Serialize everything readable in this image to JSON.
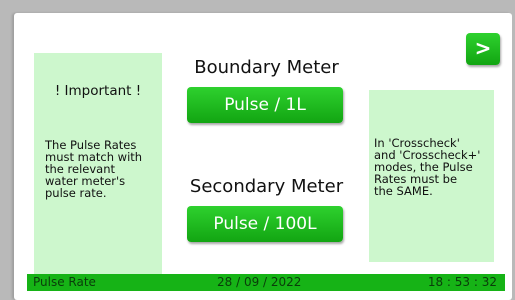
{
  "left_note": {
    "title": "! Important !",
    "body": "The Pulse Rates\nmust match with\nthe relevant\nwater meter's\npulse rate."
  },
  "right_note": {
    "body": "In 'Crosscheck'\nand 'Crosscheck+'\nmodes, the Pulse\nRates must be\nthe SAME."
  },
  "boundary": {
    "label": "Boundary Meter",
    "button": "Pulse / 1L"
  },
  "secondary": {
    "label": "Secondary Meter",
    "button": "Pulse / 100L"
  },
  "next_button": ">",
  "status_bar": {
    "label": "Pulse Rate",
    "date": "28 / 09 / 2022",
    "time": "18 : 53 : 32"
  },
  "colors": {
    "accent": "#16b316",
    "note_bg": "#cdf7cd"
  }
}
